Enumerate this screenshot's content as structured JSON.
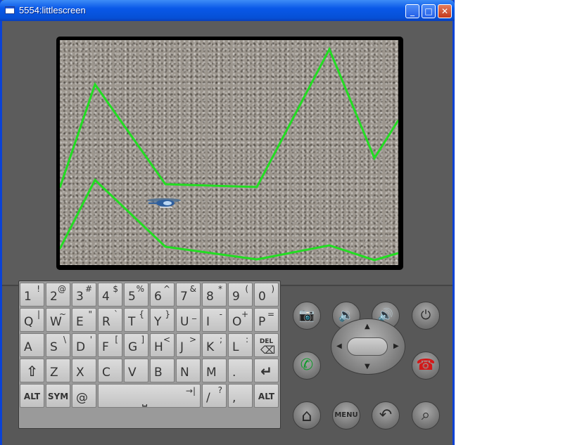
{
  "window": {
    "title": "5554:littlescreen",
    "minimize_glyph": "_",
    "maximize_glyph": "□",
    "close_glyph": "✕"
  },
  "game": {
    "description_icon": "helicopter-icon",
    "line_color": "#22dd22"
  },
  "keyboard": {
    "row1": [
      {
        "main": "1",
        "alt": "!"
      },
      {
        "main": "2",
        "alt": "@"
      },
      {
        "main": "3",
        "alt": "#"
      },
      {
        "main": "4",
        "alt": "$"
      },
      {
        "main": "5",
        "alt": "%"
      },
      {
        "main": "6",
        "alt": "^"
      },
      {
        "main": "7",
        "alt": "&"
      },
      {
        "main": "8",
        "alt": "*"
      },
      {
        "main": "9",
        "alt": "("
      },
      {
        "main": "0",
        "alt": ")"
      }
    ],
    "row2": [
      {
        "main": "Q",
        "alt": "|"
      },
      {
        "main": "W",
        "alt": "~"
      },
      {
        "main": "E",
        "alt": "\""
      },
      {
        "main": "R",
        "alt": "`"
      },
      {
        "main": "T",
        "alt": "{"
      },
      {
        "main": "Y",
        "alt": "}"
      },
      {
        "main": "U",
        "alt": "_"
      },
      {
        "main": "I",
        "alt": "-"
      },
      {
        "main": "O",
        "alt": "+"
      },
      {
        "main": "P",
        "alt": "="
      }
    ],
    "row3": [
      {
        "main": "A",
        "alt": ""
      },
      {
        "main": "S",
        "alt": "\\"
      },
      {
        "main": "D",
        "alt": "'"
      },
      {
        "main": "F",
        "alt": "["
      },
      {
        "main": "G",
        "alt": "]"
      },
      {
        "main": "H",
        "alt": "<"
      },
      {
        "main": "J",
        "alt": ">"
      },
      {
        "main": "K",
        "alt": ";"
      },
      {
        "main": "L",
        "alt": ":"
      },
      {
        "main": "DEL",
        "alt": ""
      }
    ],
    "row4": [
      {
        "main": "⇧",
        "alt": ""
      },
      {
        "main": "Z",
        "alt": ""
      },
      {
        "main": "X",
        "alt": ""
      },
      {
        "main": "C",
        "alt": ""
      },
      {
        "main": "V",
        "alt": ""
      },
      {
        "main": "B",
        "alt": ""
      },
      {
        "main": "N",
        "alt": ""
      },
      {
        "main": "M",
        "alt": ""
      },
      {
        "main": ".",
        "alt": ""
      },
      {
        "main": "↵",
        "alt": ""
      }
    ],
    "row5": {
      "alt_left": "ALT",
      "sym": "SYM",
      "at": "@",
      "space_alt": "→|",
      "space_glyph": "⎵",
      "slash": "/",
      "question": "?",
      "comma": ",",
      "alt_right": "ALT"
    }
  },
  "controls": {
    "camera": "📷",
    "vol_down": "🔉",
    "vol_up": "🔊",
    "power": "⏻",
    "call": "✆",
    "end": "☎",
    "home": "⌂",
    "menu": "MENU",
    "back": "↶",
    "search": "⌕",
    "dpad_up": "▲",
    "dpad_down": "▼",
    "dpad_left": "◀",
    "dpad_right": "▶"
  }
}
